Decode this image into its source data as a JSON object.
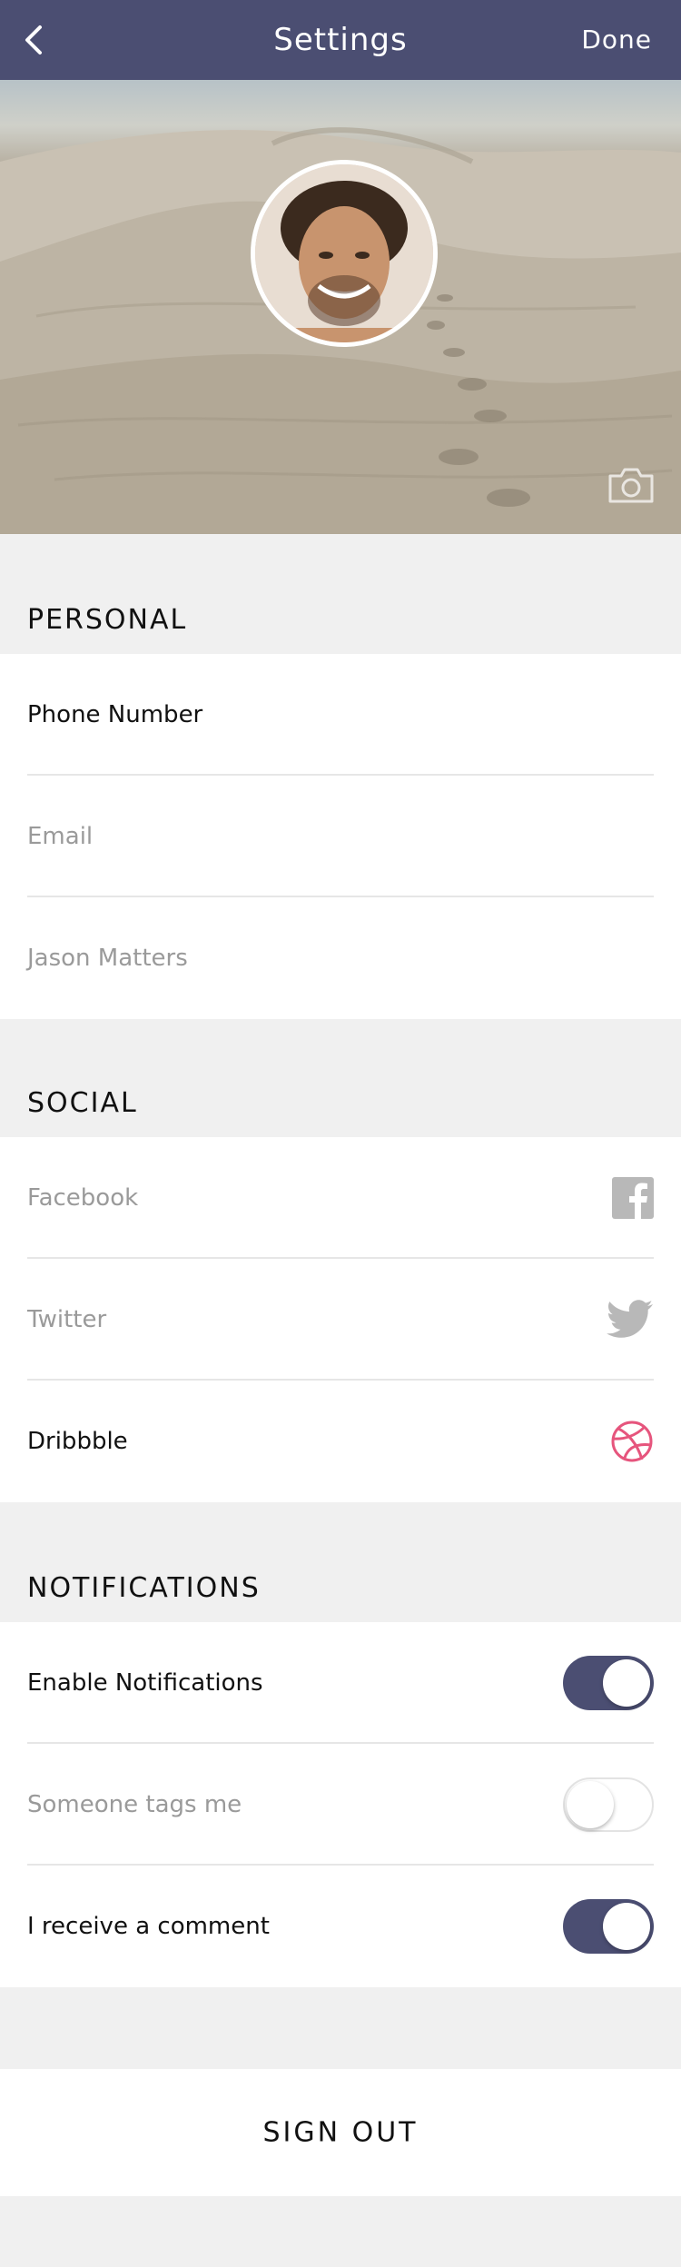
{
  "nav": {
    "title": "Settings",
    "done_label": "Done",
    "back_icon": "chevron-left-icon"
  },
  "hero": {
    "camera_icon": "camera-icon"
  },
  "personal": {
    "header": "PERSONAL",
    "rows": [
      "Phone Number",
      "Email",
      "Jason Matters"
    ]
  },
  "social": {
    "header": "SOCIAL",
    "rows": [
      "Facebook",
      "Twitter",
      "Dribbble"
    ],
    "icons": [
      "facebook-icon",
      "twitter-icon",
      "dribbble-icon"
    ]
  },
  "notifications": {
    "header": "NOTIFICATIONS",
    "rows": [
      {
        "label": "Enable Notifications",
        "on": true
      },
      {
        "label": "Someone tags me",
        "on": false
      },
      {
        "label": "I receive a comment",
        "on": true
      }
    ]
  },
  "signout_label": "SIGN OUT",
  "colors": {
    "nav": "#4b4e72",
    "toggle_on": "#4b4e72",
    "dribbble": "#e6557d",
    "muted_text": "#9a9a9a"
  }
}
